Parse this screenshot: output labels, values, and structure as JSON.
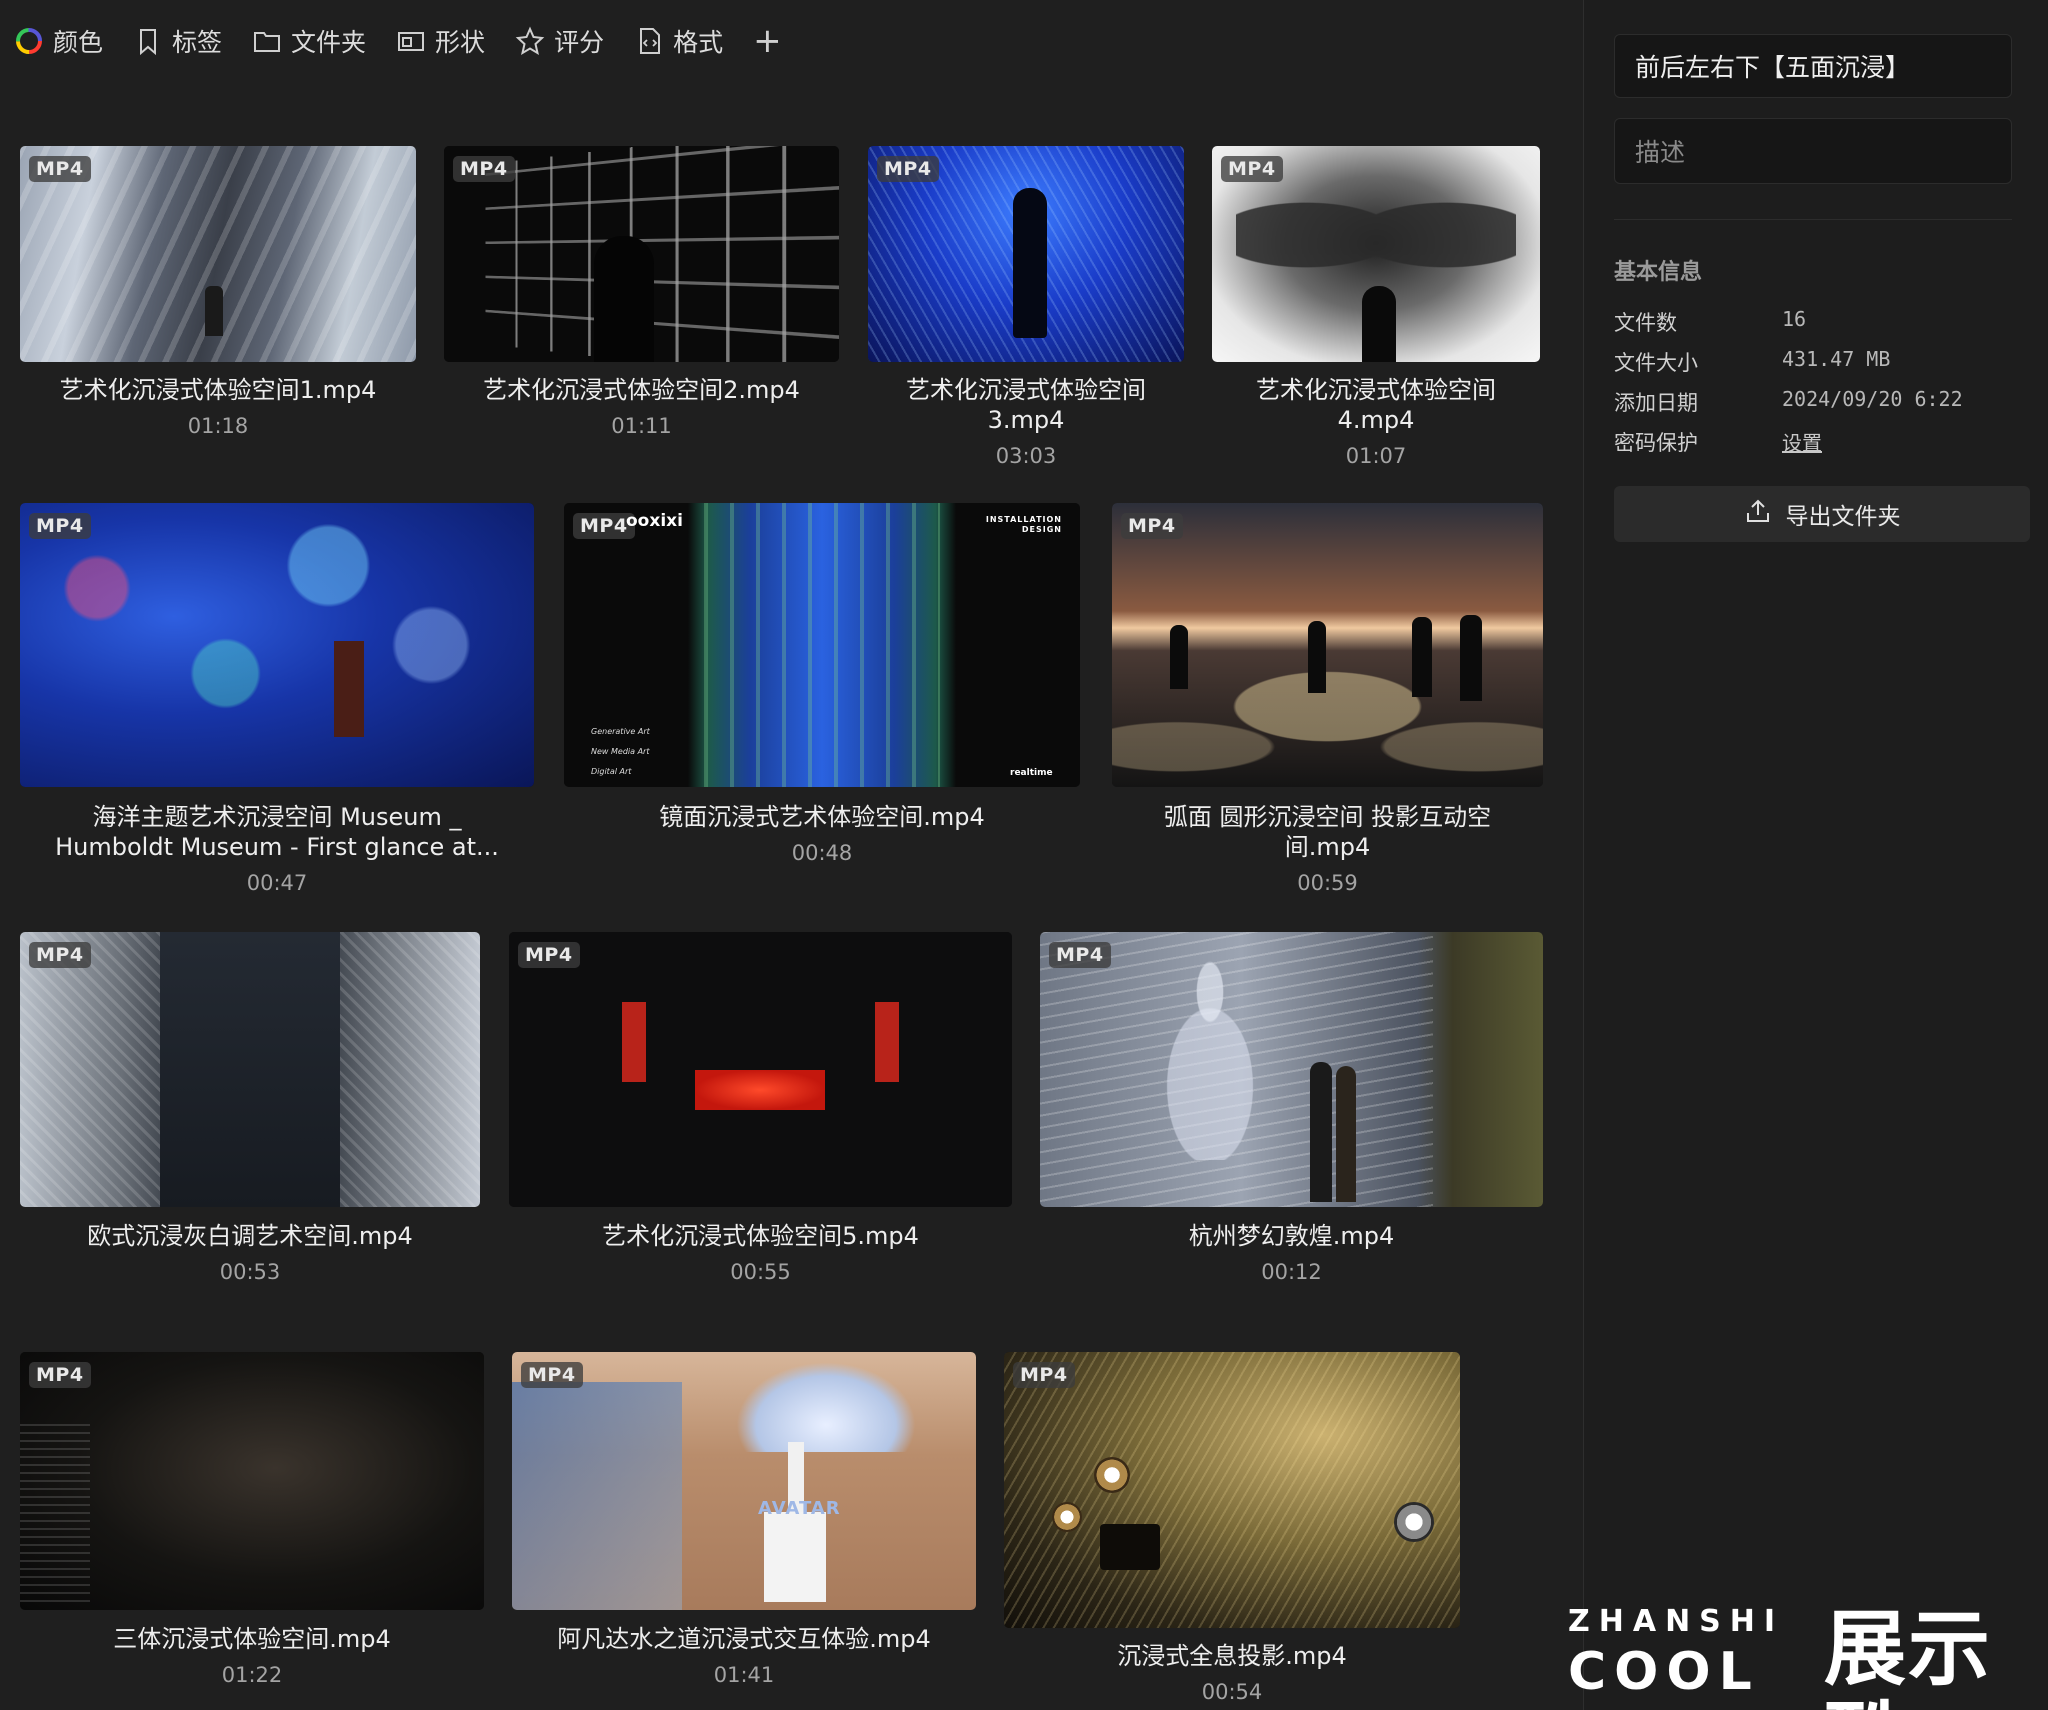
{
  "toolbar": {
    "items": [
      {
        "label": "颜色",
        "icon": "color-wheel-icon"
      },
      {
        "label": "标签",
        "icon": "bookmark-icon"
      },
      {
        "label": "文件夹",
        "icon": "folder-icon"
      },
      {
        "label": "形状",
        "icon": "shape-icon"
      },
      {
        "label": "评分",
        "icon": "star-icon"
      },
      {
        "label": "格式",
        "icon": "file-format-icon"
      }
    ],
    "add_label": "+"
  },
  "files": [
    {
      "format": "MP4",
      "title": "艺术化沉浸式体验空间1.mp4",
      "duration": "01:18"
    },
    {
      "format": "MP4",
      "title": "艺术化沉浸式体验空间2.mp4",
      "duration": "01:11"
    },
    {
      "format": "MP4",
      "title_line1": "艺术化沉浸式体验空间",
      "title_line2": "3.mp4",
      "duration": "03:03"
    },
    {
      "format": "MP4",
      "title_line1": "艺术化沉浸式体验空间",
      "title_line2": "4.mp4",
      "duration": "01:07"
    },
    {
      "format": "MP4",
      "title_line1": "海洋主题艺术沉浸空间 Museum _",
      "title_line2": "Humboldt Museum - First glance at...",
      "duration": "00:47"
    },
    {
      "format": "MP4",
      "title": "镜面沉浸式艺术体验空间.mp4",
      "duration": "00:48",
      "overlay_brand": "ooxixi",
      "overlay_tag": "INSTALLATION DESIGN",
      "overlay_list": [
        "Generative Art",
        "New Media Art",
        "Digital Art"
      ],
      "overlay_foot": "realtime"
    },
    {
      "format": "MP4",
      "title_line1": "弧面 圆形沉浸空间 投影互动空",
      "title_line2": "间.mp4",
      "duration": "00:59"
    },
    {
      "format": "MP4",
      "title": "欧式沉浸灰白调艺术空间.mp4",
      "duration": "00:53"
    },
    {
      "format": "MP4",
      "title": "艺术化沉浸式体验空间5.mp4",
      "duration": "00:55"
    },
    {
      "format": "MP4",
      "title": "杭州梦幻敦煌.mp4",
      "duration": "00:12"
    },
    {
      "format": "MP4",
      "title": "三体沉浸式体验空间.mp4",
      "duration": "01:22"
    },
    {
      "format": "MP4",
      "title": "阿凡达水之道沉浸式交互体验.mp4",
      "duration": "01:41",
      "overlay_sign": "AVATAR"
    },
    {
      "format": "MP4",
      "title": "沉浸式全息投影.mp4",
      "duration": "00:54"
    }
  ],
  "panel": {
    "folder_name": "前后左右下【五面沉浸】",
    "description_placeholder": "描述",
    "section_title": "基本信息",
    "info": [
      {
        "key": "文件数",
        "value": "16"
      },
      {
        "key": "文件大小",
        "value": "431.47 MB"
      },
      {
        "key": "添加日期",
        "value": "2024/09/20 6:22"
      },
      {
        "key": "密码保护",
        "value": "设置"
      }
    ],
    "export_label": "导出文件夹"
  },
  "watermark": {
    "en": "ZHANSHI",
    "cool": "COOL",
    "cn": "展示酷"
  },
  "colors": {
    "background": "#1f1f1f",
    "panel": "#1d1d1d",
    "accent_text": "#eeeeee"
  }
}
